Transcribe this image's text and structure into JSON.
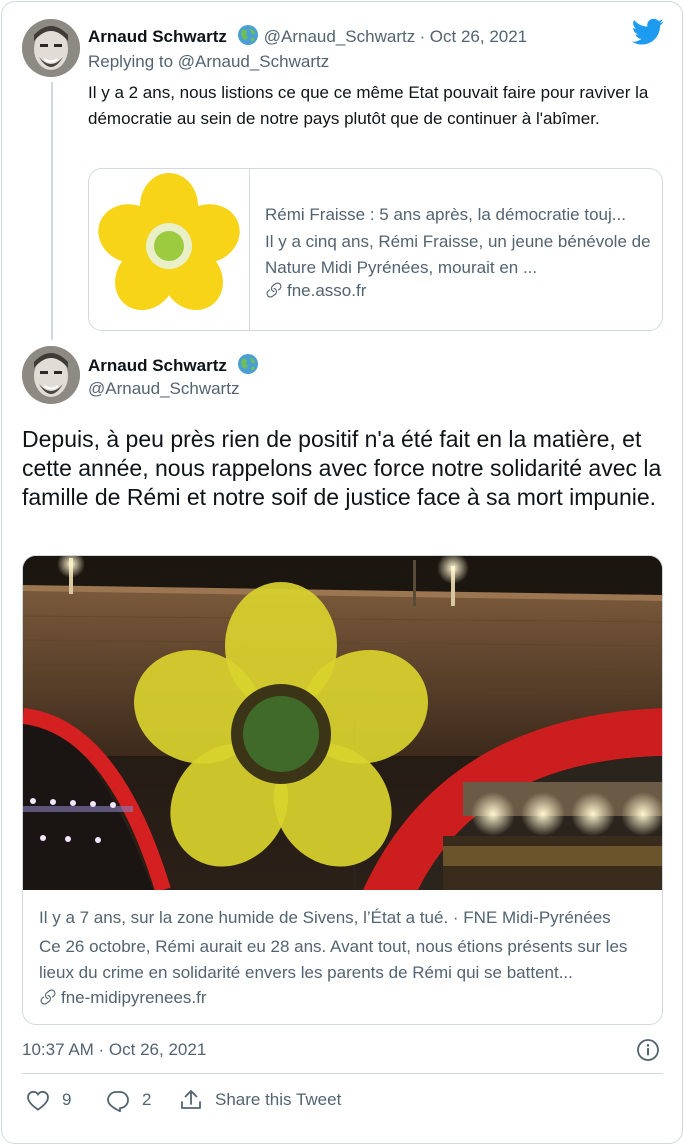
{
  "quoted_tweet": {
    "author_name": "Arnaud Schwartz",
    "author_handle": "@Arnaud_Schwartz",
    "date": "Oct 26, 2021",
    "replying_to_prefix": "Replying to ",
    "replying_to_handle": "@Arnaud_Schwartz",
    "text": "Il y a 2 ans, nous listions ce que ce même Etat pouvait faire pour raviver la démocratie au sein de notre pays plutôt que de continuer à l'abîmer.",
    "link_card": {
      "title": "Rémi Fraisse : 5 ans après, la démocratie touj...",
      "description": "Il y a cinq ans, Rémi Fraisse, un jeune bénévole de Nature Midi Pyrénées, mourait en ...",
      "domain": "fne.asso.fr"
    }
  },
  "main_tweet": {
    "author_name": "Arnaud Schwartz",
    "author_handle": "@Arnaud_Schwartz",
    "text": "Depuis, à peu près rien de positif n'a été fait en la matière, et cette année, nous rappelons avec force notre solidarité avec la famille de Rémi et notre soif de justice face à sa mort impunie.",
    "link_card": {
      "title": "Il y a 7 ans, sur la zone humide de Sivens, l’État a tué. · FNE Midi-Pyrénées",
      "description": "Ce 26 octobre, Rémi aurait eu 28 ans. Avant tout, nous étions présents sur les lieux du crime en solidarité envers les parents de Rémi qui se battent...",
      "domain": "fne-midipyrenees.fr"
    },
    "timestamp": "10:37 AM · Oct 26, 2021",
    "like_count": "9",
    "reply_count": "2",
    "share_label": "Share this Tweet"
  },
  "icons": {
    "brand": "twitter-bird-icon",
    "info": "info-icon",
    "like": "heart-icon",
    "reply": "reply-bubble-icon",
    "share": "share-upload-icon",
    "link": "link-icon",
    "badge": "globe-emoji-icon"
  },
  "colors": {
    "twitter_blue": "#1d9bf0",
    "text_primary": "#0f1419",
    "text_secondary": "#536471",
    "border": "#cfd9de",
    "flower_yellow": "#f7d417"
  }
}
